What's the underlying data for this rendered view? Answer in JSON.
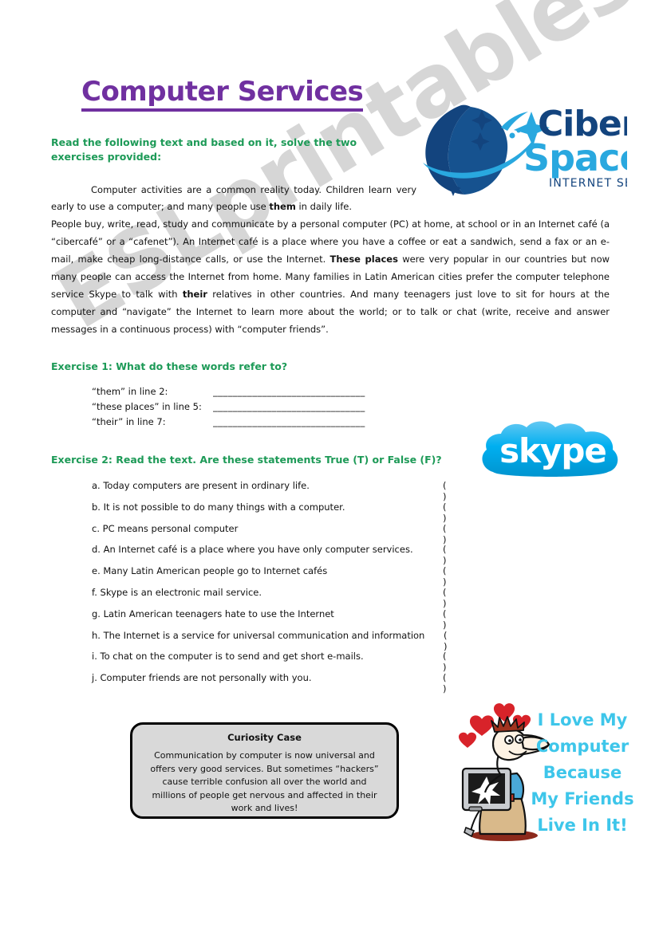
{
  "document": {
    "title": "Computer Services",
    "instruction": "Read the following text and based on it, solve the two exercises provided:",
    "paragraph_1": "Computer activities are a common reality today. Children learn very early to use a computer; and many people use them in daily life.",
    "paragraph_1_bold": "them",
    "paragraph_2": "People buy, write, read, study and communicate by a personal computer (PC) at home, at school or in an Internet café (a “cibercafé” or a “cafenet”). An Internet café is a place where you have a coffee or eat a sandwich, send a fax or an e-mail, make cheap long-distance calls, or use the Internet. These places were very popular in our countries but now many people can access the Internet from home. Many families in Latin American cities prefer the computer telephone service Skype to talk with their relatives in other countries. And many teenagers just love to sit for hours at the computer and “navigate” the Internet to learn more about the world; or to talk or chat (write, receive and answer messages in a continuous process) with “computer friends”.",
    "paragraph_2_bold_1": "These places",
    "paragraph_2_bold_2": "their"
  },
  "exercise_1": {
    "heading": "Exercise 1: What do these words refer to?",
    "answer_line": "_______________________________",
    "items": [
      {
        "label": "“them” in line 2:"
      },
      {
        "label": "“these places” in line 5:"
      },
      {
        "label": "“their” in line 7:"
      }
    ]
  },
  "exercise_2": {
    "heading": "Exercise 2: Read the text. Are these statements True (T) or False (F)?",
    "answer_box": "(    )",
    "items": [
      {
        "text": "a. Today computers are present in ordinary life."
      },
      {
        "text": "b. It is not possible to do many things with a computer."
      },
      {
        "text": "c. PC means personal computer"
      },
      {
        "text": "d. An Internet café is a place where you have only computer services."
      },
      {
        "text": "e. Many Latin American people go to Internet cafés"
      },
      {
        "text": "f. Skype is an electronic mail service."
      },
      {
        "text": "g. Latin American teenagers hate to use the Internet"
      },
      {
        "text": "h. The Internet is a service for universal communication and information"
      },
      {
        "text": "i. To chat on the computer is to send and get short e-mails."
      },
      {
        "text": "j. Computer friends are not personally with you."
      }
    ]
  },
  "curiosity_case": {
    "title": "Curiosity Case",
    "body": "Communication by computer is now universal and offers very good services. But sometimes “hackers” cause terrible confusion all over the world and millions of people get nervous and affected in their work and lives!"
  },
  "ciber_logo": {
    "word_1": "Ciber",
    "word_2": "Space",
    "tagline": "INTERNET SERVICE",
    "color_dark": "#13447e",
    "color_light": "#29a8df"
  },
  "skype_logo": {
    "wordmark": "skype",
    "trademark": "™",
    "color": "#00aff0"
  },
  "cartoon": {
    "line_1": "I Love My",
    "line_2": "Computer",
    "line_3": "Because",
    "line_4": "My Friends",
    "line_5": "Live In It!",
    "color": "#3ec6ea"
  },
  "watermark": {
    "text": "ESLprintables.com",
    "color": "#c9c9c9"
  }
}
